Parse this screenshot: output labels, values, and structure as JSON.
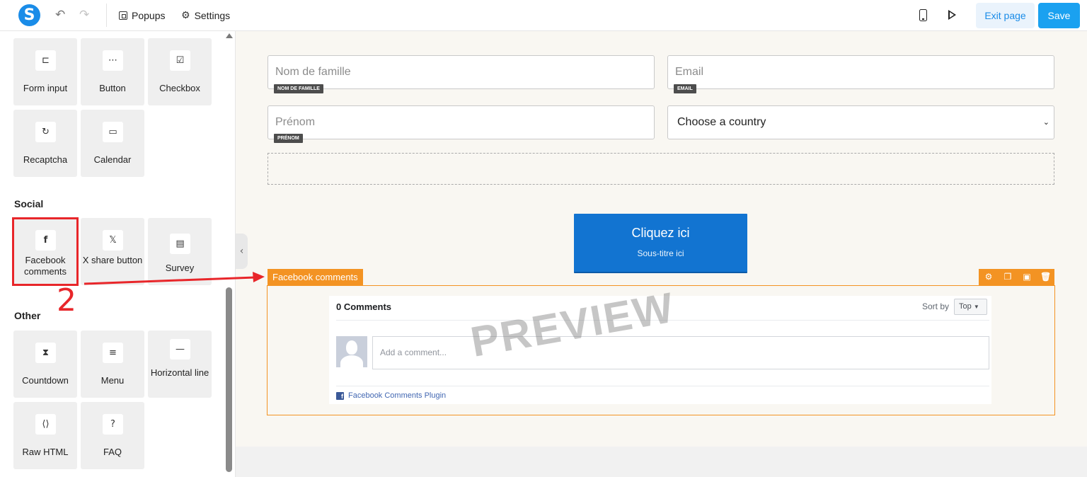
{
  "topbar": {
    "logo_letter": "S",
    "popups_label": "Popups",
    "settings_label": "Settings",
    "exit_label": "Exit page",
    "save_label": "Save"
  },
  "sidebar": {
    "form_tiles": [
      {
        "label": "Form input",
        "icon": "form-input-icon"
      },
      {
        "label": "Button",
        "icon": "button-icon"
      },
      {
        "label": "Checkbox",
        "icon": "checkbox-icon"
      },
      {
        "label": "Recaptcha",
        "icon": "recaptcha-icon"
      },
      {
        "label": "Calendar",
        "icon": "calendar-icon"
      }
    ],
    "social_title": "Social",
    "social_tiles": [
      {
        "label": "Facebook comments",
        "icon": "facebook-icon"
      },
      {
        "label": "X share button",
        "icon": "x-icon"
      },
      {
        "label": "Survey",
        "icon": "survey-icon"
      }
    ],
    "other_title": "Other",
    "other_tiles": [
      {
        "label": "Countdown",
        "icon": "hourglass-icon"
      },
      {
        "label": "Menu",
        "icon": "menu-icon"
      },
      {
        "label": "Horizontal line",
        "icon": "horizontal-line-icon"
      },
      {
        "label": "Raw HTML",
        "icon": "code-icon"
      },
      {
        "label": "FAQ",
        "icon": "question-icon"
      }
    ]
  },
  "form": {
    "last_name": {
      "placeholder": "Nom de famille",
      "tag": "NOM DE FAMILLE"
    },
    "email": {
      "placeholder": "Email",
      "tag": "EMAIL"
    },
    "first_name": {
      "placeholder": "Prénom",
      "tag": "PRÉNOM"
    },
    "country": {
      "selected": "Choose a country"
    }
  },
  "cta": {
    "title": "Cliquez ici",
    "subtitle": "Sous-titre ici"
  },
  "fb_widget": {
    "label": "Facebook comments",
    "count": "0 Comments",
    "sort_label": "Sort by",
    "sort_value": "Top",
    "comment_placeholder": "Add a comment...",
    "plugin_label": "Facebook Comments Plugin",
    "watermark": "PREVIEW"
  },
  "annotation": {
    "number": "2",
    "color": "#e8262a"
  },
  "colors": {
    "accent": "#1a8ce8",
    "widget_orange": "#f39323",
    "cta_blue": "#1274d1"
  }
}
